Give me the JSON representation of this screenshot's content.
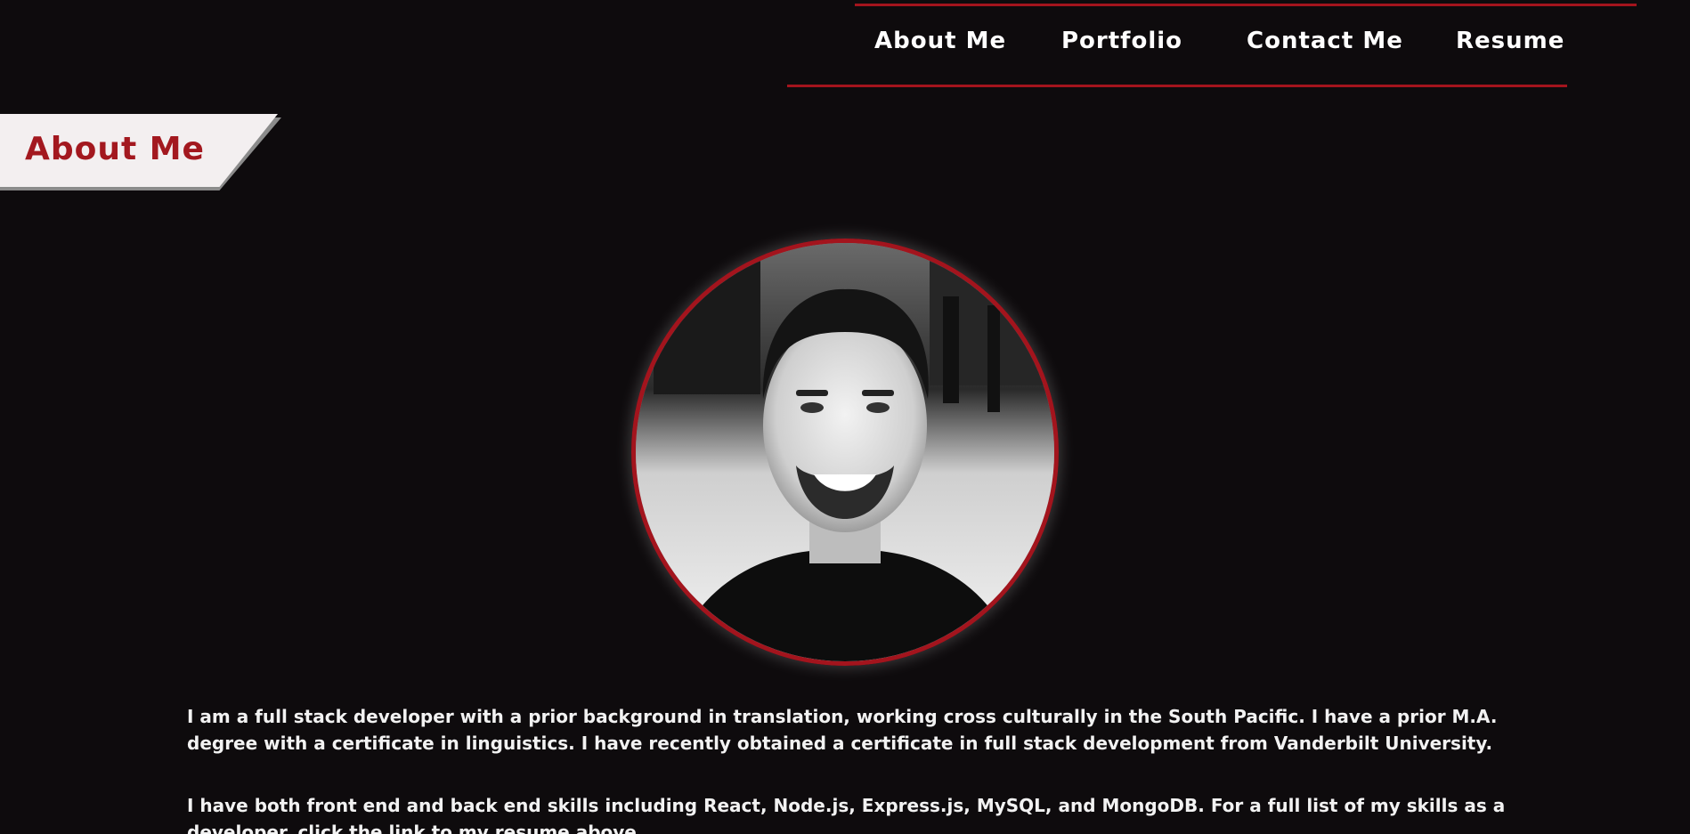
{
  "nav": {
    "items": [
      {
        "label": "About Me"
      },
      {
        "label": "Portfolio"
      },
      {
        "label": "Contact Me"
      },
      {
        "label": "Resume"
      }
    ]
  },
  "section": {
    "title": "About Me"
  },
  "profile": {
    "photo_alt": "Profile photo"
  },
  "about": {
    "paragraph1": "I am a full stack developer with a prior background in translation, working cross culturally in the South Pacific. I have a prior M.A. degree with a certificate in linguistics. I have recently obtained a certificate in full stack development from Vanderbilt University.",
    "paragraph2": "I have both front end and back end skills including React, Node.js, Express.js, MySQL, and MongoDB. For a full list of my skills as a developer, click the link to my resume above."
  },
  "colors": {
    "background": "#0e0b0d",
    "accent": "#a3141d",
    "banner_bg": "#f3eff0",
    "text": "#f2f2f2"
  }
}
